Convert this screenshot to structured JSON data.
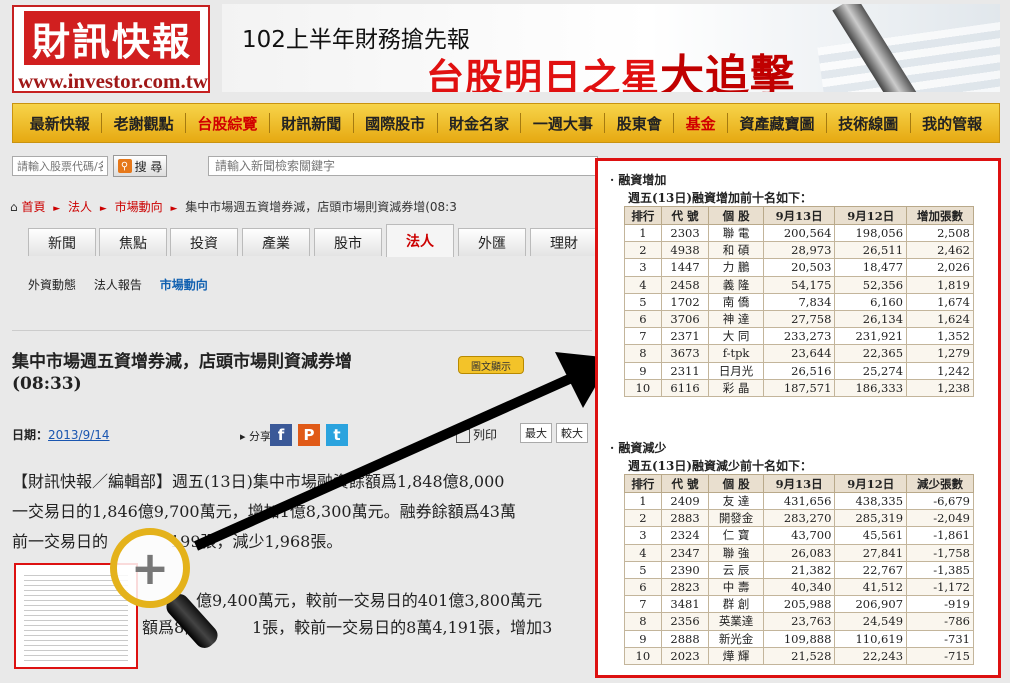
{
  "logo": {
    "main": "財訊快報",
    "url": "www.investor.com.tw"
  },
  "banner": {
    "sub": "102上半年財務搶先報",
    "main_prefix": "台股明日之星",
    "main_highlight": "大追擊"
  },
  "nav": {
    "items": [
      {
        "label": "最新快報",
        "highlight": false
      },
      {
        "label": "老謝觀點",
        "highlight": false
      },
      {
        "label": "台股綜覽",
        "highlight": true
      },
      {
        "label": "財訊新聞",
        "highlight": false
      },
      {
        "label": "國際股市",
        "highlight": false
      },
      {
        "label": "財金名家",
        "highlight": false
      },
      {
        "label": "一週大事",
        "highlight": false
      },
      {
        "label": "股東會",
        "highlight": false
      },
      {
        "label": "基金",
        "highlight": true
      },
      {
        "label": "資產藏寶圖",
        "highlight": false
      },
      {
        "label": "技術線圖",
        "highlight": false
      },
      {
        "label": "我的管報",
        "highlight": false
      }
    ]
  },
  "search": {
    "stock_placeholder": "請輸入股票代碼/名",
    "button": "搜 尋",
    "news_placeholder": "請輸入新聞檢索關鍵字"
  },
  "breadcrumb": {
    "home": "首頁",
    "b1": "法人",
    "b2": "市場動向",
    "current": "集中市場週五資增券減，店頭市場則資減券增(08:3"
  },
  "tabs": [
    "新聞",
    "焦點",
    "投資",
    "產業",
    "股市",
    "法人",
    "外匯",
    "理財"
  ],
  "subnav": [
    "外資動態",
    "法人報告",
    "市場動向"
  ],
  "article": {
    "title": "集中市場週五資增券減，店頭市場則資減券增",
    "photo_badge": "圖文顯示",
    "time": "(08:33)",
    "date_label": "日期：",
    "date": "2013/9/14",
    "share": "分享",
    "print": "列印",
    "font_big": "最大",
    "font_larger": "較大",
    "p1a": "【財訊快報／編輯部】週五(13日)集中市場融資餘額爲1,848億8,000",
    "p1b": "一交易日的1,846億9,700萬元，增加1億8,300萬元。融券餘額爲43萬",
    "p1c": "前一交易日的",
    "p1d": "199張，減少1,968張。",
    "p2a": "億9,400萬元，較前一交易日的401億3,800萬元",
    "p2b": "額爲8萬",
    "p2c": "1張，較前一交易日的8萬4,191張，增加3"
  },
  "zoom": {
    "inc_title": "· 融資增加",
    "inc_sub": "週五(13日)融資增加前十名如下：",
    "inc_headers": [
      "排行",
      "代  號",
      "個  股",
      "9月13日",
      "9月12日",
      "增加張數"
    ],
    "inc_rows": [
      [
        "1",
        "2303",
        "聯  電",
        "200,564",
        "198,056",
        "2,508"
      ],
      [
        "2",
        "4938",
        "和  碩",
        "28,973",
        "26,511",
        "2,462"
      ],
      [
        "3",
        "1447",
        "力  鵬",
        "20,503",
        "18,477",
        "2,026"
      ],
      [
        "4",
        "2458",
        "義  隆",
        "54,175",
        "52,356",
        "1,819"
      ],
      [
        "5",
        "1702",
        "南  僑",
        "7,834",
        "6,160",
        "1,674"
      ],
      [
        "6",
        "3706",
        "神  達",
        "27,758",
        "26,134",
        "1,624"
      ],
      [
        "7",
        "2371",
        "大  同",
        "233,273",
        "231,921",
        "1,352"
      ],
      [
        "8",
        "3673",
        "f-tpk",
        "23,644",
        "22,365",
        "1,279"
      ],
      [
        "9",
        "2311",
        "日月光",
        "26,516",
        "25,274",
        "1,242"
      ],
      [
        "10",
        "6116",
        "彩  晶",
        "187,571",
        "186,333",
        "1,238"
      ]
    ],
    "dec_title": "· 融資減少",
    "dec_sub": "週五(13日)融資減少前十名如下：",
    "dec_headers": [
      "排行",
      "代  號",
      "個  股",
      "9月13日",
      "9月12日",
      "減少張數"
    ],
    "dec_rows": [
      [
        "1",
        "2409",
        "友  達",
        "431,656",
        "438,335",
        "-6,679"
      ],
      [
        "2",
        "2883",
        "開發金",
        "283,270",
        "285,319",
        "-2,049"
      ],
      [
        "3",
        "2324",
        "仁  寶",
        "43,700",
        "45,561",
        "-1,861"
      ],
      [
        "4",
        "2347",
        "聯  強",
        "26,083",
        "27,841",
        "-1,758"
      ],
      [
        "5",
        "2390",
        "云  辰",
        "21,382",
        "22,767",
        "-1,385"
      ],
      [
        "6",
        "2823",
        "中  壽",
        "40,340",
        "41,512",
        "-1,172"
      ],
      [
        "7",
        "3481",
        "群  創",
        "205,988",
        "206,907",
        "-919"
      ],
      [
        "8",
        "2356",
        "英業達",
        "23,763",
        "24,549",
        "-786"
      ],
      [
        "9",
        "2888",
        "新光金",
        "109,888",
        "110,619",
        "-731"
      ],
      [
        "10",
        "2023",
        "燁  輝",
        "21,528",
        "22,243",
        "-715"
      ]
    ]
  },
  "colors": {
    "accent_red": "#d11f1f",
    "nav_gold": "#e6a912",
    "link_blue": "#1a56b0"
  }
}
